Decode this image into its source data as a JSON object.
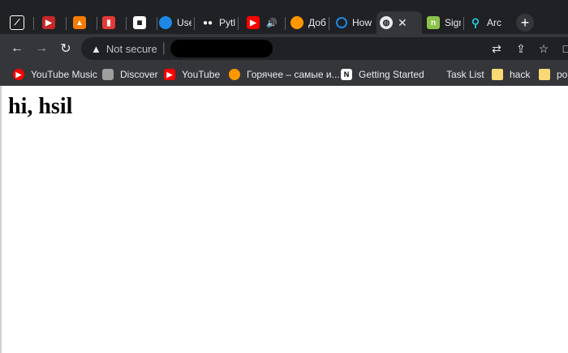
{
  "tabs": [
    {
      "title": "",
      "icon": "slash-logo-icon",
      "color": "#ffffff"
    },
    {
      "title": "",
      "icon": "red-flag-icon",
      "color": "#c62828"
    },
    {
      "title": "",
      "icon": "orange-blocks-icon",
      "color": "#f57c00"
    },
    {
      "title": "",
      "icon": "trello-icon",
      "color": "#e53935"
    },
    {
      "title": "",
      "icon": "qr-icon",
      "color": "#ffffff"
    },
    {
      "title": "Use",
      "icon": "database-icon",
      "color": "#1e88e5"
    },
    {
      "title": "Pytl",
      "icon": "medium-icon",
      "color": "#ffffff"
    },
    {
      "title": "",
      "icon": "youtube-icon",
      "color": "#ff0000"
    },
    {
      "title": "Доб",
      "icon": "sun-icon",
      "color": "#ff9800"
    },
    {
      "title": "How",
      "icon": "refresh-blue-icon",
      "color": "#1e88e5"
    },
    {
      "title": "",
      "icon": "globe-icon",
      "color": "#e8eaed"
    },
    {
      "title": "Sign",
      "icon": "n-green-icon",
      "color": "#8bc34a"
    },
    {
      "title": "Arc",
      "icon": "arc-icon",
      "color": "#26c6da"
    }
  ],
  "toolbar": {
    "security_label": "Not secure"
  },
  "bookmarks": [
    {
      "label": "YouTube Music",
      "icon": "youtube-music-icon",
      "color": "#ff0000"
    },
    {
      "label": "Discover",
      "icon": "discover-icon",
      "color": "#9e9e9e"
    },
    {
      "label": "YouTube",
      "icon": "youtube-icon",
      "color": "#ff0000"
    },
    {
      "label": "Горячее – самые и...",
      "icon": "sun-icon",
      "color": "#ff9800"
    },
    {
      "label": "Getting Started",
      "icon": "notion-icon",
      "color": "#ffffff"
    },
    {
      "label": "Task List",
      "icon": "",
      "color": ""
    },
    {
      "label": "hack",
      "icon": "folder-icon",
      "color": "#f9d976"
    },
    {
      "label": "po",
      "icon": "folder-icon",
      "color": "#f9d976"
    }
  ],
  "page": {
    "heading": "hi, hsil"
  }
}
